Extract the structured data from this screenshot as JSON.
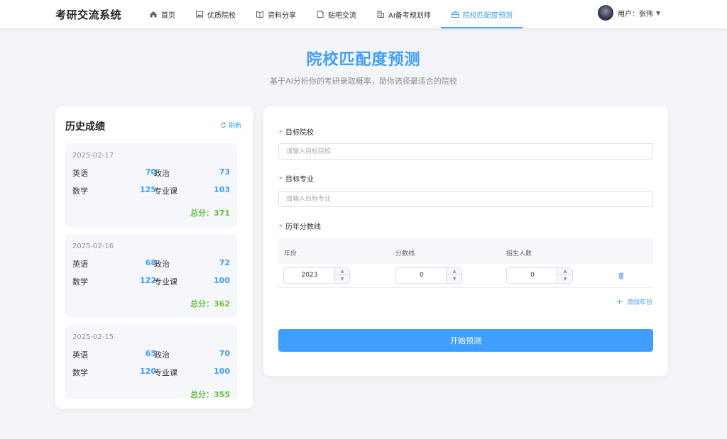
{
  "brand": "考研交流系统",
  "nav": [
    {
      "label": "首页",
      "icon": "home-icon"
    },
    {
      "label": "优质院校",
      "icon": "picture-icon"
    },
    {
      "label": "资料分享",
      "icon": "book-icon"
    },
    {
      "label": "贴吧交流",
      "icon": "note-icon"
    },
    {
      "label": "AI备考规划师",
      "icon": "building-icon"
    },
    {
      "label": "院校匹配度预测",
      "icon": "briefcase-icon",
      "active": true
    }
  ],
  "user": {
    "label": "用户：张伟"
  },
  "page": {
    "title": "院校匹配度预测",
    "subtitle": "基于AI分析你的考研录取概率，助你选择最适合的院校"
  },
  "history": {
    "title": "历史成绩",
    "refresh_label": "刷新",
    "records": [
      {
        "date": "2025-02-17",
        "english_label": "英语",
        "english": "70",
        "politics_label": "政治",
        "politics": "73",
        "math_label": "数学",
        "math": "125",
        "major_label": "专业课",
        "major": "103",
        "total": "总分：371"
      },
      {
        "date": "2025-02-16",
        "english_label": "英语",
        "english": "68",
        "politics_label": "政治",
        "politics": "72",
        "math_label": "数学",
        "math": "122",
        "major_label": "专业课",
        "major": "100",
        "total": "总分：362"
      },
      {
        "date": "2025-02-15",
        "english_label": "英语",
        "english": "65",
        "politics_label": "政治",
        "politics": "70",
        "math_label": "数学",
        "math": "120",
        "major_label": "专业课",
        "major": "100",
        "total": "总分：355"
      }
    ]
  },
  "form": {
    "school_label": "目标院校",
    "school_placeholder": "请输入目标院校",
    "school_value": "",
    "major_label": "目标专业",
    "major_placeholder": "请输入目标专业",
    "major_value": "",
    "scores_label": "历年分数线",
    "table": {
      "headers": [
        "年份",
        "分数线",
        "招生人数"
      ],
      "rows": [
        {
          "year": "2023",
          "score": "0",
          "count": "0"
        }
      ]
    },
    "add_year_label": "添加年份",
    "submit_label": "开始预测"
  },
  "colors": {
    "accent": "#409eff",
    "total": "#67c23a",
    "required": "#f56c6c"
  }
}
